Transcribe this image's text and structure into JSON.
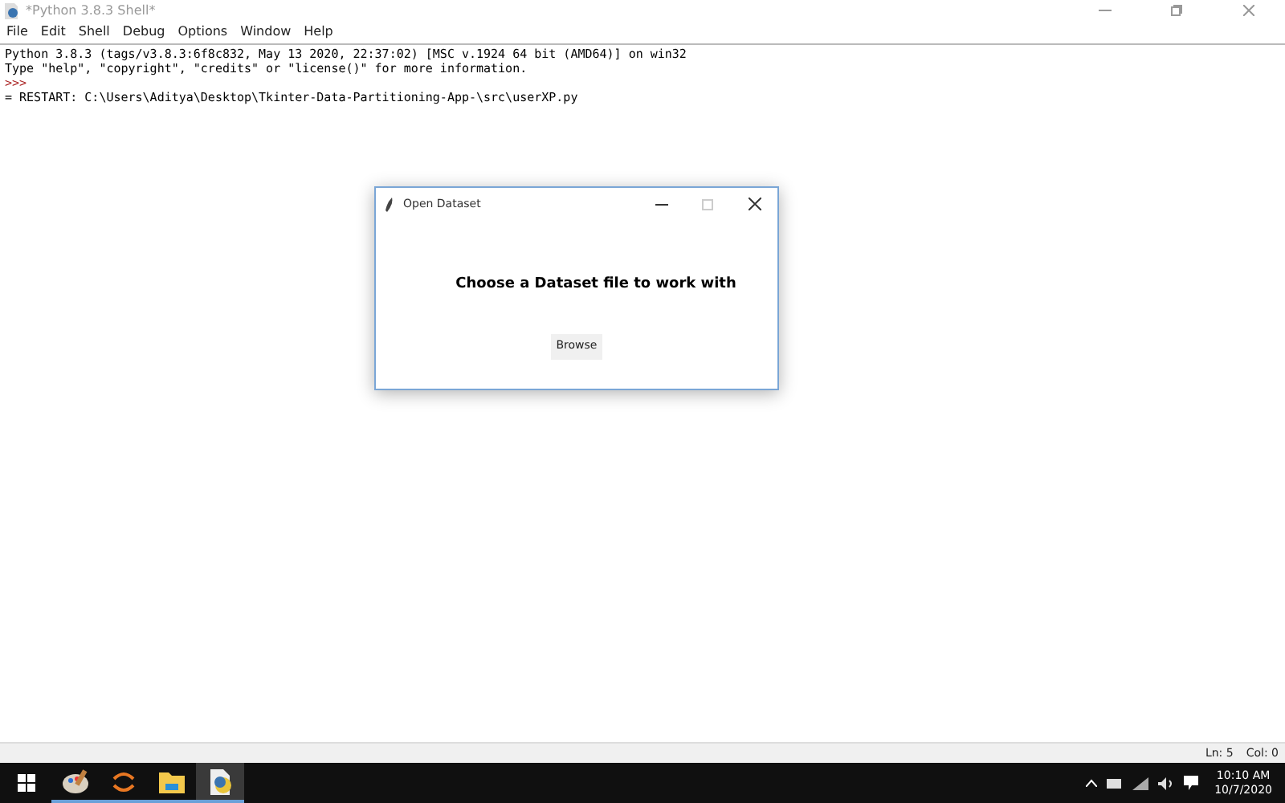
{
  "window": {
    "title": "*Python 3.8.3 Shell*"
  },
  "menu": [
    "File",
    "Edit",
    "Shell",
    "Debug",
    "Options",
    "Window",
    "Help"
  ],
  "shell_lines": [
    {
      "kind": "output",
      "text": "Python 3.8.3 (tags/v3.8.3:6f8c832, May 13 2020, 22:37:02) [MSC v.1924 64 bit (AMD64)] on win32"
    },
    {
      "kind": "output",
      "text": "Type \"help\", \"copyright\", \"credits\" or \"license()\" for more information."
    },
    {
      "kind": "prompt",
      "text": ">>>"
    },
    {
      "kind": "output",
      "text": "= RESTART: C:\\Users\\Aditya\\Desktop\\Tkinter-Data-Partitioning-App-\\src\\userXP.py"
    }
  ],
  "dialog": {
    "title": "Open Dataset",
    "message": "Choose a Dataset file to work with",
    "button": "Browse"
  },
  "status_bar": {
    "line": "Ln: 5",
    "col": "Col: 0"
  },
  "taskbar": {
    "apps": [
      {
        "kind": "paint",
        "selected": false
      },
      {
        "kind": "sync",
        "selected": false
      },
      {
        "kind": "folder",
        "selected": false
      },
      {
        "kind": "idle",
        "selected": true
      }
    ],
    "time": "10:10 AM",
    "date": "10/7/2020"
  }
}
